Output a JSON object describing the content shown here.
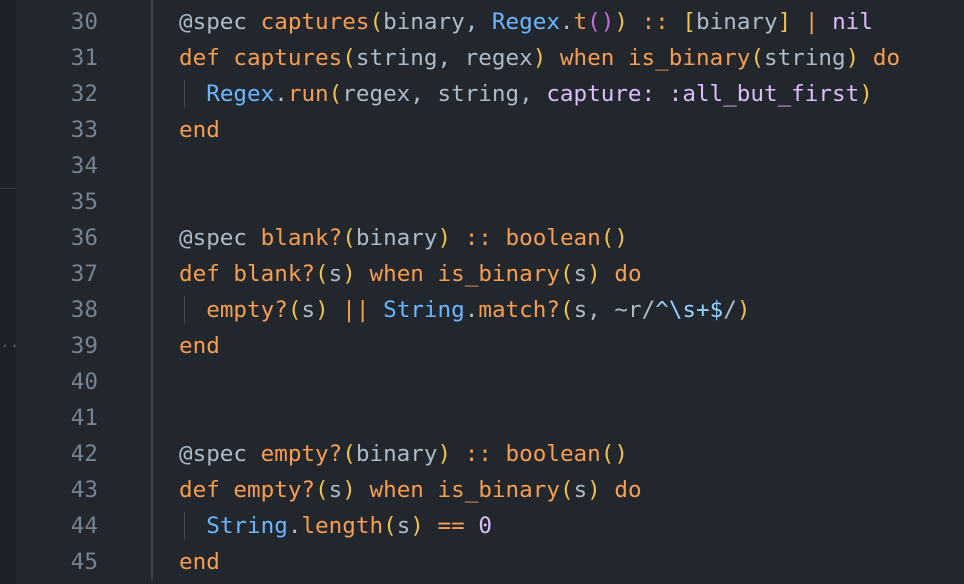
{
  "editor": {
    "side_dots": "..",
    "lines": [
      {
        "n": "30",
        "tokens": [
          {
            "t": "@spec",
            "c": "attr"
          },
          {
            "t": " "
          },
          {
            "t": "captures",
            "c": "fn"
          },
          {
            "t": "(",
            "c": "br1"
          },
          {
            "t": "binary",
            "c": "pl"
          },
          {
            "t": ", "
          },
          {
            "t": "Regex",
            "c": "mod"
          },
          {
            "t": ".",
            "c": "pl"
          },
          {
            "t": "t",
            "c": "fn"
          },
          {
            "t": "()",
            "c": "br2"
          },
          {
            "t": ")",
            "c": "br1"
          },
          {
            "t": " "
          },
          {
            "t": "::",
            "c": "op"
          },
          {
            "t": " "
          },
          {
            "t": "[",
            "c": "br1"
          },
          {
            "t": "binary",
            "c": "pl"
          },
          {
            "t": "]",
            "c": "br1"
          },
          {
            "t": " "
          },
          {
            "t": "|",
            "c": "op"
          },
          {
            "t": " "
          },
          {
            "t": "nil",
            "c": "atom"
          }
        ]
      },
      {
        "n": "31",
        "tokens": [
          {
            "t": "def",
            "c": "kw"
          },
          {
            "t": " "
          },
          {
            "t": "captures",
            "c": "fn"
          },
          {
            "t": "(",
            "c": "br1"
          },
          {
            "t": "string, regex",
            "c": "pl"
          },
          {
            "t": ")",
            "c": "br1"
          },
          {
            "t": " "
          },
          {
            "t": "when",
            "c": "kw"
          },
          {
            "t": " "
          },
          {
            "t": "is_binary",
            "c": "fn"
          },
          {
            "t": "(",
            "c": "br1"
          },
          {
            "t": "string",
            "c": "pl"
          },
          {
            "t": ")",
            "c": "br1"
          },
          {
            "t": " "
          },
          {
            "t": "do",
            "c": "kw"
          }
        ]
      },
      {
        "n": "32",
        "indent": true,
        "tokens": [
          {
            "t": "  "
          },
          {
            "t": "Regex",
            "c": "mod"
          },
          {
            "t": ".",
            "c": "pl"
          },
          {
            "t": "run",
            "c": "fn"
          },
          {
            "t": "(",
            "c": "br1"
          },
          {
            "t": "regex, string, ",
            "c": "pl"
          },
          {
            "t": "capture:",
            "c": "atom"
          },
          {
            "t": " "
          },
          {
            "t": ":all_but_first",
            "c": "atom"
          },
          {
            "t": ")",
            "c": "br1"
          }
        ]
      },
      {
        "n": "33",
        "tokens": [
          {
            "t": "end",
            "c": "kw"
          }
        ]
      },
      {
        "n": "34",
        "tokens": []
      },
      {
        "n": "35",
        "tokens": []
      },
      {
        "n": "36",
        "tokens": [
          {
            "t": "@spec",
            "c": "attr"
          },
          {
            "t": " "
          },
          {
            "t": "blank?",
            "c": "fn"
          },
          {
            "t": "(",
            "c": "br1"
          },
          {
            "t": "binary",
            "c": "pl"
          },
          {
            "t": ")",
            "c": "br1"
          },
          {
            "t": " "
          },
          {
            "t": "::",
            "c": "op"
          },
          {
            "t": " "
          },
          {
            "t": "boolean",
            "c": "fn"
          },
          {
            "t": "()",
            "c": "br1"
          }
        ]
      },
      {
        "n": "37",
        "tokens": [
          {
            "t": "def",
            "c": "kw"
          },
          {
            "t": " "
          },
          {
            "t": "blank?",
            "c": "fn"
          },
          {
            "t": "(",
            "c": "br1"
          },
          {
            "t": "s",
            "c": "pl"
          },
          {
            "t": ")",
            "c": "br1"
          },
          {
            "t": " "
          },
          {
            "t": "when",
            "c": "kw"
          },
          {
            "t": " "
          },
          {
            "t": "is_binary",
            "c": "fn"
          },
          {
            "t": "(",
            "c": "br1"
          },
          {
            "t": "s",
            "c": "pl"
          },
          {
            "t": ")",
            "c": "br1"
          },
          {
            "t": " "
          },
          {
            "t": "do",
            "c": "kw"
          }
        ]
      },
      {
        "n": "38",
        "indent": true,
        "tokens": [
          {
            "t": "  "
          },
          {
            "t": "empty?",
            "c": "fn"
          },
          {
            "t": "(",
            "c": "br1"
          },
          {
            "t": "s",
            "c": "pl"
          },
          {
            "t": ")",
            "c": "br1"
          },
          {
            "t": " "
          },
          {
            "t": "||",
            "c": "op"
          },
          {
            "t": " "
          },
          {
            "t": "String",
            "c": "mod"
          },
          {
            "t": ".",
            "c": "pl"
          },
          {
            "t": "match?",
            "c": "fn"
          },
          {
            "t": "(",
            "c": "br1"
          },
          {
            "t": "s, ",
            "c": "pl"
          },
          {
            "t": "~r/",
            "c": "pl"
          },
          {
            "t": "^\\s+$",
            "c": "re"
          },
          {
            "t": "/",
            "c": "pl"
          },
          {
            "t": ")",
            "c": "br1"
          }
        ]
      },
      {
        "n": "39",
        "tokens": [
          {
            "t": "end",
            "c": "kw"
          }
        ]
      },
      {
        "n": "40",
        "tokens": []
      },
      {
        "n": "41",
        "tokens": []
      },
      {
        "n": "42",
        "tokens": [
          {
            "t": "@spec",
            "c": "attr"
          },
          {
            "t": " "
          },
          {
            "t": "empty?",
            "c": "fn"
          },
          {
            "t": "(",
            "c": "br1"
          },
          {
            "t": "binary",
            "c": "pl"
          },
          {
            "t": ")",
            "c": "br1"
          },
          {
            "t": " "
          },
          {
            "t": "::",
            "c": "op"
          },
          {
            "t": " "
          },
          {
            "t": "boolean",
            "c": "fn"
          },
          {
            "t": "()",
            "c": "br1"
          }
        ]
      },
      {
        "n": "43",
        "tokens": [
          {
            "t": "def",
            "c": "kw"
          },
          {
            "t": " "
          },
          {
            "t": "empty?",
            "c": "fn"
          },
          {
            "t": "(",
            "c": "br1"
          },
          {
            "t": "s",
            "c": "pl"
          },
          {
            "t": ")",
            "c": "br1"
          },
          {
            "t": " "
          },
          {
            "t": "when",
            "c": "kw"
          },
          {
            "t": " "
          },
          {
            "t": "is_binary",
            "c": "fn"
          },
          {
            "t": "(",
            "c": "br1"
          },
          {
            "t": "s",
            "c": "pl"
          },
          {
            "t": ")",
            "c": "br1"
          },
          {
            "t": " "
          },
          {
            "t": "do",
            "c": "kw"
          }
        ]
      },
      {
        "n": "44",
        "indent": true,
        "tokens": [
          {
            "t": "  "
          },
          {
            "t": "String",
            "c": "mod"
          },
          {
            "t": ".",
            "c": "pl"
          },
          {
            "t": "length",
            "c": "fn"
          },
          {
            "t": "(",
            "c": "br1"
          },
          {
            "t": "s",
            "c": "pl"
          },
          {
            "t": ")",
            "c": "br1"
          },
          {
            "t": " "
          },
          {
            "t": "==",
            "c": "op"
          },
          {
            "t": " "
          },
          {
            "t": "0",
            "c": "num"
          }
        ]
      },
      {
        "n": "45",
        "tokens": [
          {
            "t": "end",
            "c": "kw"
          }
        ]
      }
    ]
  }
}
